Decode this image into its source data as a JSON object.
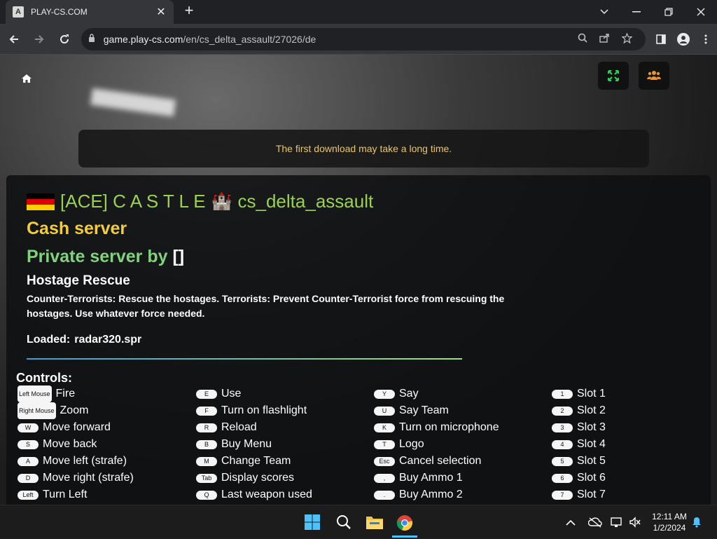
{
  "browser": {
    "tab": {
      "title": "PLAY-CS.COM",
      "favicon_letter": "A"
    },
    "url_host": "game.play-cs.com",
    "url_path": "/en/cs_delta_assault/27026/de"
  },
  "page": {
    "notice": "The first download may take a long time.",
    "server": {
      "name": "[ACE] C A S T L E",
      "castle_emoji": "🏰",
      "map": "cs_delta_assault",
      "flag_colors": [
        "#000000",
        "#dd0000",
        "#ffce00"
      ]
    },
    "mode_title": "Cash server",
    "private_label": "Private server by",
    "private_owner": "[]",
    "mission_title": "Hostage Rescue",
    "mission_desc": "Counter-Terrorists: Rescue the hostages. Terrorists: Prevent Counter-Terrorist force from rescuing the hostages. Use whatever force needed.",
    "loaded_label": "Loaded:",
    "loaded_file": "radar320.spr",
    "controls_title": "Controls:",
    "controls": {
      "col1": [
        {
          "key": "Left Mouse",
          "label": "Fire"
        },
        {
          "key": "Right Mouse",
          "label": "Zoom"
        },
        {
          "key": "W",
          "label": "Move forward"
        },
        {
          "key": "S",
          "label": "Move back"
        },
        {
          "key": "A",
          "label": "Move left (strafe)"
        },
        {
          "key": "D",
          "label": "Move right (strafe)"
        },
        {
          "key": "Left",
          "label": "Turn Left"
        }
      ],
      "col2": [
        {
          "key": "E",
          "label": "Use"
        },
        {
          "key": "F",
          "label": "Turn on flashlight"
        },
        {
          "key": "R",
          "label": "Reload"
        },
        {
          "key": "B",
          "label": "Buy Menu"
        },
        {
          "key": "M",
          "label": "Change Team"
        },
        {
          "key": "Tab",
          "label": "Display scores"
        },
        {
          "key": "Q",
          "label": "Last weapon used"
        }
      ],
      "col3": [
        {
          "key": "Y",
          "label": "Say"
        },
        {
          "key": "U",
          "label": "Say Team"
        },
        {
          "key": "K",
          "label": "Turn on microphone"
        },
        {
          "key": "T",
          "label": "Logo"
        },
        {
          "key": "Esc",
          "label": "Cancel selection"
        },
        {
          "key": ",",
          "label": "Buy Ammo 1"
        },
        {
          "key": ".",
          "label": "Buy Ammo 2"
        }
      ],
      "col4": [
        {
          "key": "1",
          "label": "Slot 1"
        },
        {
          "key": "2",
          "label": "Slot 2"
        },
        {
          "key": "3",
          "label": "Slot 3"
        },
        {
          "key": "4",
          "label": "Slot 4"
        },
        {
          "key": "5",
          "label": "Slot 5"
        },
        {
          "key": "6",
          "label": "Slot 6"
        },
        {
          "key": "7",
          "label": "Slot 7"
        }
      ]
    },
    "load_progress": 1.0
  },
  "taskbar": {
    "time": "12:11 AM",
    "date": "1/2/2024"
  }
}
